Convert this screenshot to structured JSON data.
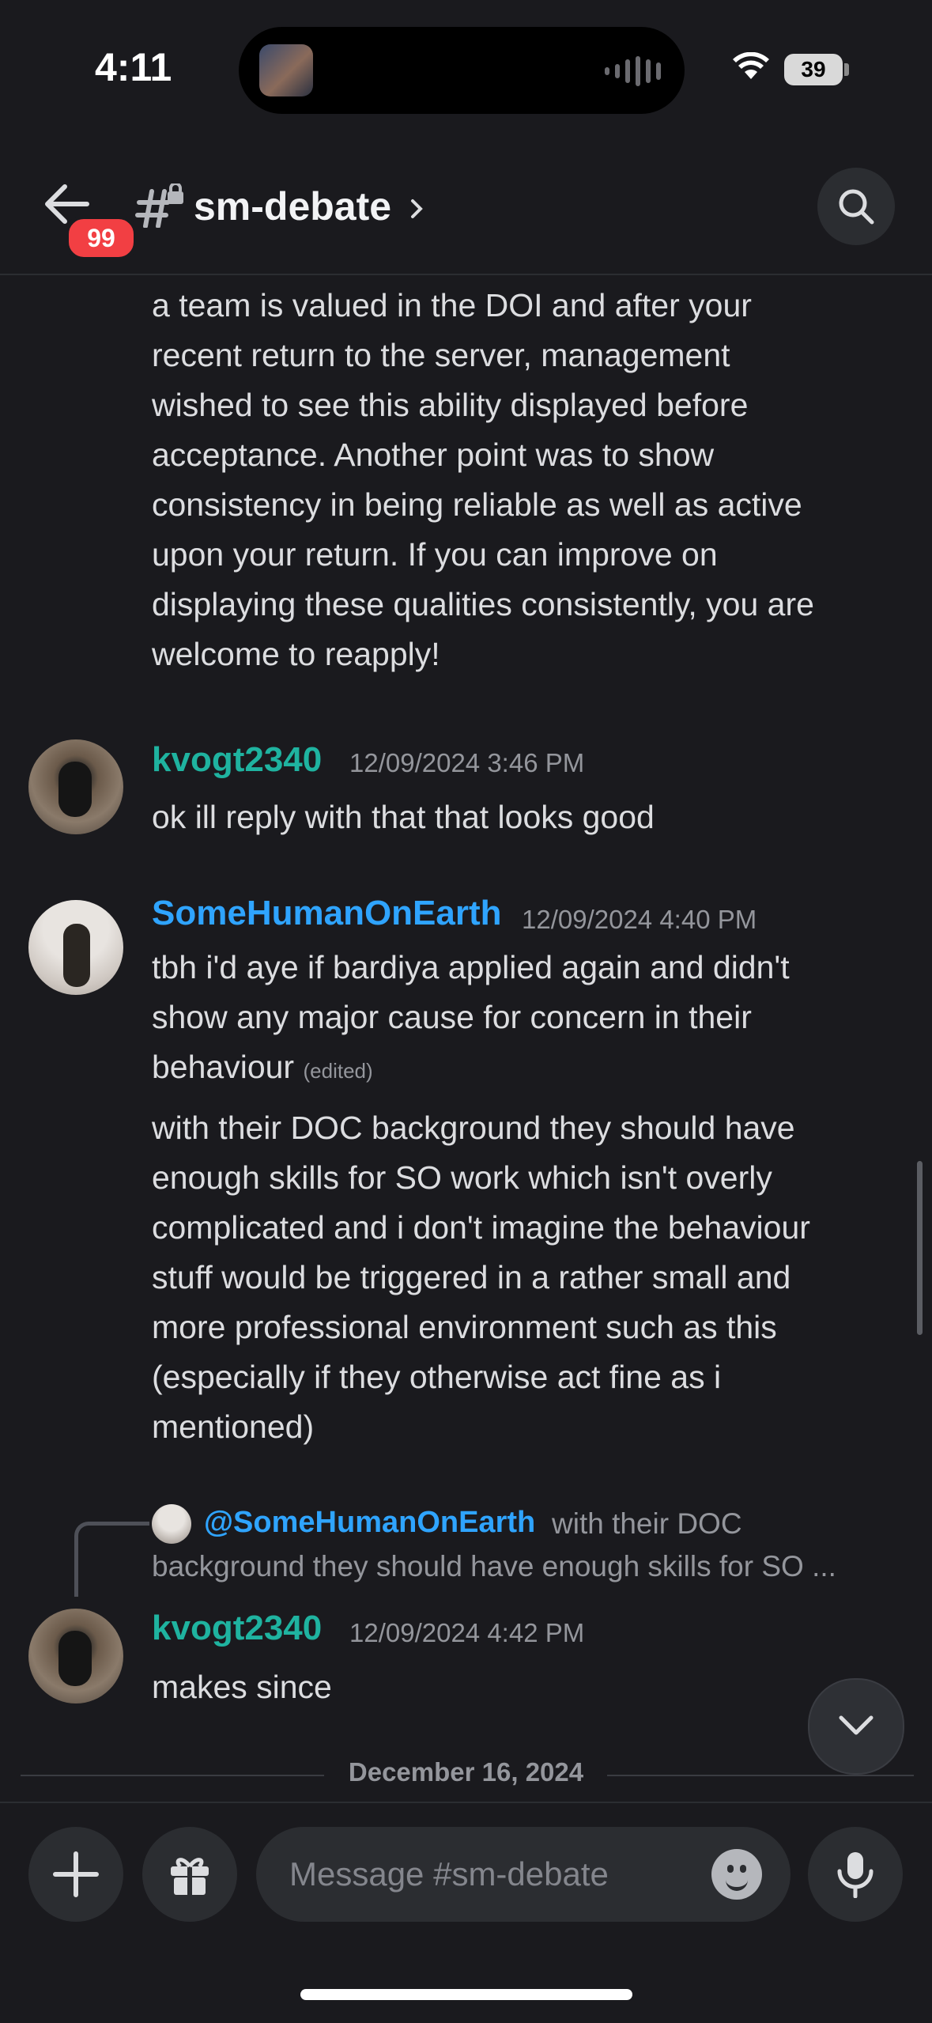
{
  "status": {
    "time": "4:11",
    "battery": "39"
  },
  "header": {
    "badge": "99",
    "channel": "sm-debate"
  },
  "messages": {
    "cont_lines": [
      "a team is valued in the DOI and after your",
      "recent return to the server, management",
      "wished to see this ability displayed before",
      "acceptance. Another point was to show",
      "consistency in being reliable as well as active",
      "upon your return. If you can improve on",
      "displaying these qualities consistently, you are",
      "welcome to reapply!"
    ],
    "m1": {
      "user": "kvogt2340",
      "time": "12/09/2024 3:46 PM",
      "text": "ok ill reply with that that looks good"
    },
    "m2": {
      "user": "SomeHumanOnEarth",
      "time": "12/09/2024 4:40 PM",
      "line1": "tbh i'd aye if bardiya applied again and didn't",
      "line2": "show any major cause for concern in their",
      "line3": "behaviour",
      "edited": "(edited)",
      "p2": [
        "with their DOC background they should have",
        "enough skills for SO work which isn't overly",
        "complicated and i don't imagine the behaviour",
        "stuff would be triggered in a rather small and",
        "more professional environment such as this",
        "(especially if they otherwise act fine as i",
        "mentioned)"
      ]
    },
    "reply": {
      "name": "@SomeHumanOnEarth",
      "snip1": "with their DOC",
      "snip2": "background they should have enough skills for SO ..."
    },
    "m3": {
      "user": "kvogt2340",
      "time": "12/09/2024 4:42 PM",
      "text": "makes since"
    }
  },
  "divider_date": "December 16, 2024",
  "composer": {
    "placeholder": "Message #sm-debate"
  },
  "colors": {
    "teal_user": "#1fb3a0",
    "blue_user": "#2fa4ff",
    "badge": "#f23f43"
  }
}
